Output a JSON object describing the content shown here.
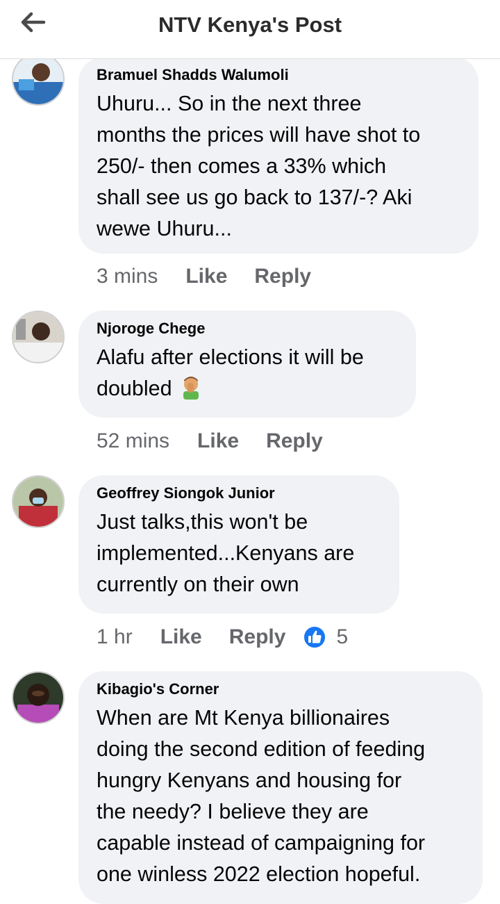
{
  "header": {
    "title": "NTV Kenya's Post",
    "back_icon": "arrow-left-icon"
  },
  "comments": [
    {
      "author": "Bramuel Shadds Walumoli",
      "text": "Uhuru... So in the next three\nmonths the prices will have shot to\n250/- then comes a 33% which\nshall see us go back to 137/-? Aki\nwewe Uhuru...",
      "time": "3 mins",
      "like": "Like",
      "reply": "Reply"
    },
    {
      "author": "Njoroge Chege",
      "text": "Alafu after elections it will be\ndoubled",
      "emoji": "man-facepalming-emoji",
      "time": "52 mins",
      "like": "Like",
      "reply": "Reply"
    },
    {
      "author": "Geoffrey Siongok Junior",
      "text": "Just talks,this won't be\nimplemented...Kenyans are\ncurrently on their own",
      "time": "1 hr",
      "like": "Like",
      "reply": "Reply",
      "reaction_icon": "thumbs-up-icon",
      "reaction_count": "5"
    },
    {
      "author": "Kibagio's Corner",
      "text": "When are Mt Kenya billionaires\ndoing the second edition of feeding\nhungry Kenyans and housing for\nthe needy? I believe they are\ncapable instead of campaigning for\none  winless 2022 election hopeful.",
      "time": "",
      "like": "",
      "reply": ""
    }
  ],
  "colors": {
    "bubble": "#f0f2f5",
    "meta_text": "#65676b",
    "like_blue": "#1877f2"
  }
}
